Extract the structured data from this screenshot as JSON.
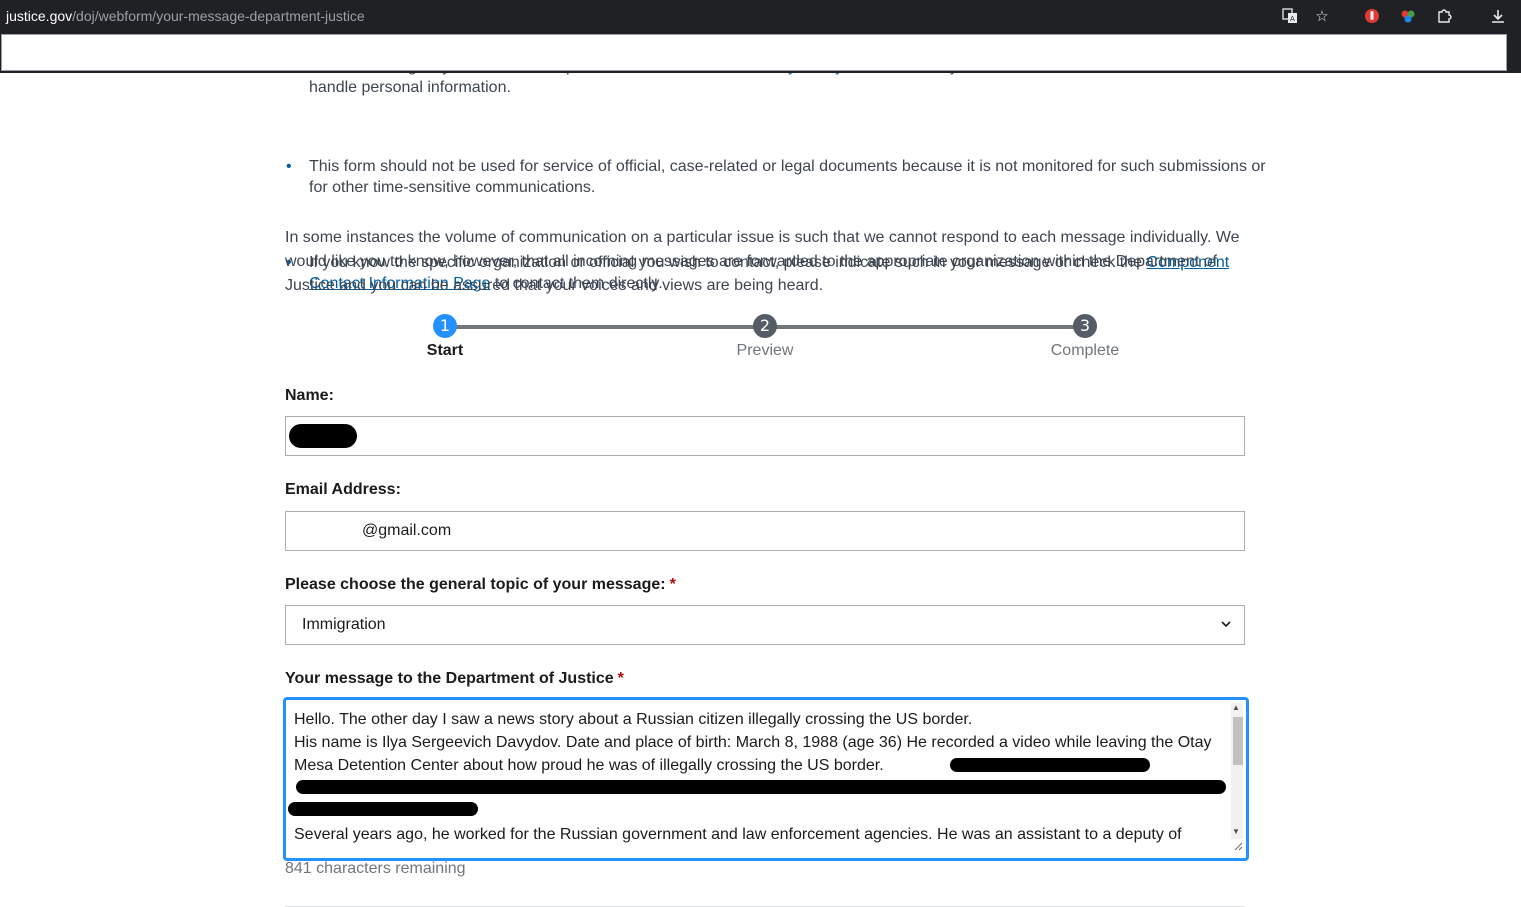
{
  "browser": {
    "url_host": "justice.gov",
    "url_path": "/doj/webform/your-message-department-justice",
    "icons": [
      "translate-icon",
      "star-icon",
      "extension-red-icon",
      "extension-colorful-icon",
      "extensions-puzzle-icon",
      "download-icon"
    ]
  },
  "intro": {
    "bullet1_before": "Before sending us your information, please read our ",
    "bullet1_link": "Website Privacy Policy",
    "bullet1_after": " and the Privacy Statement below for details about how we handle personal information.",
    "bullet2": "This form should not be used for service of official, case-related or legal documents because it is not monitored for such submissions or for other time-sensitive communications.",
    "bullet3_before": "If you know the specific organization or official you wish to contact, please indicate such in your message or check the ",
    "bullet3_link": "Component Contact Information Page",
    "bullet3_after": " to contact them directly.",
    "paragraph": "In some instances the volume of  communication on a particular issue is such that we cannot respond to each message individually. We would like you to know, however, that all incoming messages are forwarded to the appropriate organization within the Department of Justice and you can be assured that your voices and views are being heard."
  },
  "stepper": {
    "steps": [
      {
        "num": "1",
        "label": "Start"
      },
      {
        "num": "2",
        "label": "Preview"
      },
      {
        "num": "3",
        "label": "Complete"
      }
    ],
    "current": 1
  },
  "form": {
    "name_label": "Name:",
    "name_value": "",
    "email_label": "Email Address:",
    "email_value": "@gmail.com",
    "topic_label": "Please choose the general topic of your message:",
    "topic_required": "*",
    "topic_value": "Immigration",
    "message_label": "Your message to the Department of Justice",
    "message_required": "*",
    "message_line1": "Hello. The other day I saw a news story about a Russian citizen illegally crossing the US border.",
    "message_line2": "His name is Ilya Sergeevich Davydov. Date and place of birth: March 8, 1988 (age 36) He recorded a video while leaving the Otay Mesa Detention Center about how proud he was of illegally crossing the US border.",
    "message_line4": "Several years ago, he worked for the Russian government and law enforcement agencies. He was an assistant to a deputy of",
    "chars_remaining": "841 characters remaining"
  },
  "colors": {
    "accent": "#2491ff",
    "link": "#005ea2",
    "required": "#b50909",
    "chrome": "#202124"
  }
}
